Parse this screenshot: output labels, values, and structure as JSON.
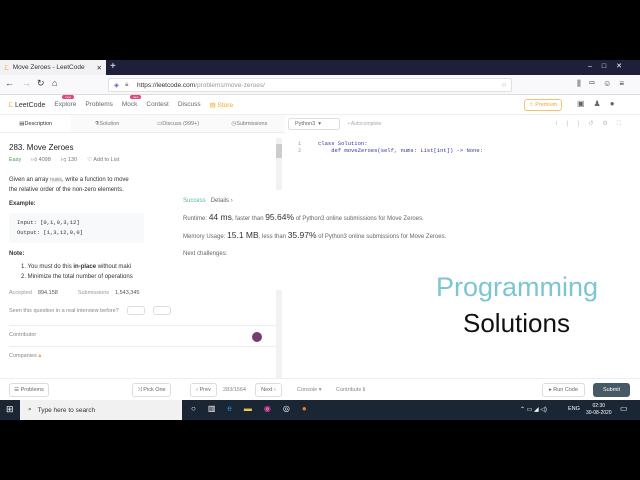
{
  "browser": {
    "tab_title": "Move Zeroes - LeetCode",
    "url_host": "https://leetcode.com",
    "url_path": "/problems/move-zeroes/",
    "new_tab": "+"
  },
  "nav": {
    "logo": "LeetCode",
    "items": [
      "Explore",
      "Problems",
      "Mock",
      "Contest",
      "Discuss",
      "Store"
    ],
    "badge": "new",
    "premium": "☆ Premium"
  },
  "subtabs": [
    "Description",
    "Solution",
    "Discuss (999+)",
    "Submissions"
  ],
  "problem": {
    "title": "283. Move Zeroes",
    "difficulty": "Easy",
    "likes": "4098",
    "dislikes": "130",
    "add_to_list": "Add to List",
    "desc1": "Given an array ",
    "desc_code": "nums",
    "desc2": ", write a function to move",
    "desc3": "the relative order of the non-zero elements.",
    "example_label": "Example:",
    "input": "Input: [0,1,0,3,12]",
    "output": "Output: [1,3,12,0,0]",
    "note_label": "Note:",
    "note1_a": "1. You must do this ",
    "note1_b": "in-place",
    "note1_c": " without maki",
    "note2": "2. Minimize the total number of operations",
    "accepted_label": "Accepted",
    "accepted": "894,158",
    "submissions_label": "Submissions",
    "submissions": "1,543,345",
    "interview": "Seen this question in a real interview before?",
    "yes": "Yes",
    "no": "No",
    "contributor": "Contributor",
    "companies": "Companies"
  },
  "editor": {
    "language": "Python3",
    "autocomplete": "Autocomplete",
    "lines": [
      "1",
      "2"
    ],
    "code": [
      "class Solution:",
      "    def moveZeroes(self, nums: List[int]) -> None:"
    ]
  },
  "result": {
    "status": "Success",
    "details": "Details ›",
    "runtime_label": "Runtime: ",
    "runtime": "44 ms",
    "runtime_mid": ", faster than ",
    "runtime_pct": "95.64%",
    "runtime_tail": " of Python3 online submissions for Move Zeroes.",
    "mem_label": "Memory Usage: ",
    "mem": "15.1 MB",
    "mem_mid": ", less than ",
    "mem_pct": "35.97%",
    "mem_tail": " of Python3 online submissions for Move Zeroes.",
    "next": "Next challenges:"
  },
  "bottom": {
    "problems": "☰ Problems",
    "pick": "⤨ Pick One",
    "prev": "‹ Prev",
    "page": "283/1564",
    "next": "Next ›",
    "console": "Console ▾",
    "contribute": "Contribute ℹ",
    "run": "▸ Run Code",
    "submit": "Submit"
  },
  "overlay": {
    "line1": "Programming",
    "line2": "Solutions"
  },
  "taskbar": {
    "search": "Type here to search",
    "lang": "ENG",
    "time": "02:30",
    "date": "30-08-2020"
  },
  "colors": {
    "easy": "#43a047",
    "success": "#5ab5a6",
    "submit": "#455a64"
  }
}
